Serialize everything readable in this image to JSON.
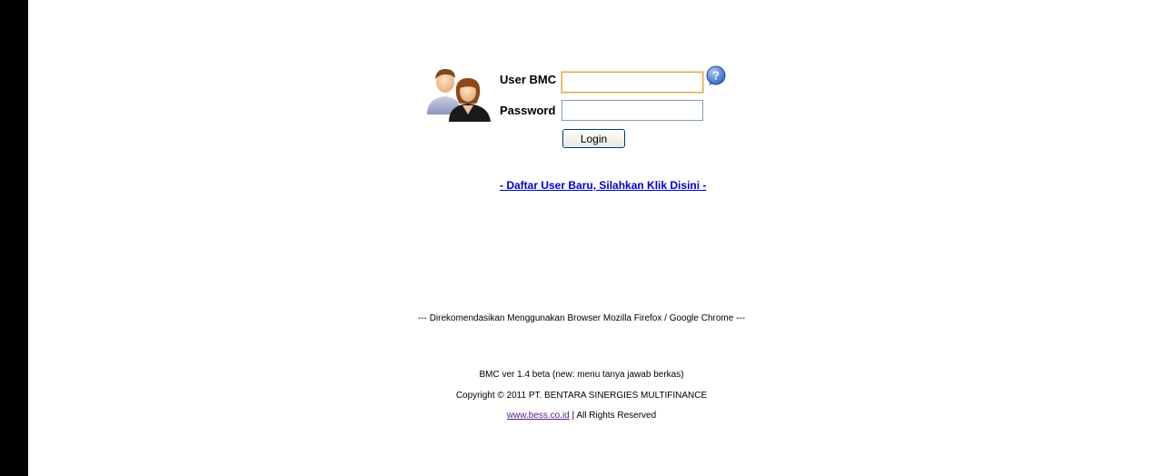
{
  "login": {
    "user_label": "User BMC",
    "password_label": "Password",
    "user_value": "",
    "password_value": "",
    "login_button": "Login"
  },
  "register_link": "- Daftar User Baru, Silahkan Klik Disini -",
  "footer": {
    "recommend": "--- Direkomendasikan Menggunakan Browser Mozilla Firefox / Google Chrome ---",
    "version": "BMC ver 1.4 beta (new: menu tanya jawab berkas)",
    "copyright": "Copyright © 2011 PT. BENTARA SINERGIES MULTIFINANCE",
    "site": "www.bess.co.id",
    "rights": " | All Rights Reserved"
  },
  "icons": {
    "illustration": "users-icon",
    "help": "help-icon"
  },
  "colors": {
    "link": "#0000cc",
    "visited_link": "#551a8b",
    "input_focus_border": "#e6a23c"
  }
}
